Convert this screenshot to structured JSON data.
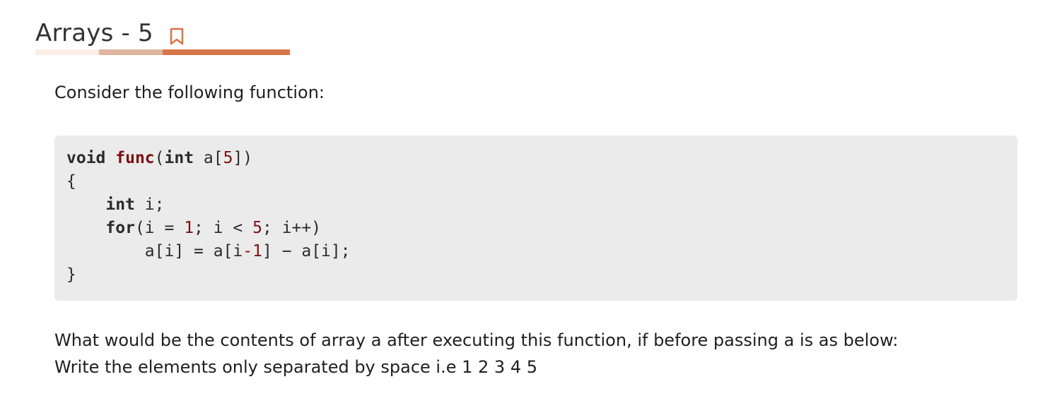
{
  "header": {
    "title": "Arrays - 5",
    "bookmark_icon": "bookmark-icon",
    "accent_color": "#d6774a"
  },
  "intro": {
    "text": "Consider the following function:"
  },
  "code": {
    "lines": [
      [
        {
          "t": "void",
          "c": "kw"
        },
        {
          "t": " ",
          "c": ""
        },
        {
          "t": "func",
          "c": "fn"
        },
        {
          "t": "(",
          "c": ""
        },
        {
          "t": "int",
          "c": "kw"
        },
        {
          "t": " a[",
          "c": ""
        },
        {
          "t": "5",
          "c": "num"
        },
        {
          "t": "])",
          "c": ""
        }
      ],
      [
        {
          "t": "{",
          "c": ""
        }
      ],
      [
        {
          "t": "    ",
          "c": ""
        },
        {
          "t": "int",
          "c": "kw"
        },
        {
          "t": " i;",
          "c": ""
        }
      ],
      [
        {
          "t": "    ",
          "c": ""
        },
        {
          "t": "for",
          "c": "kw"
        },
        {
          "t": "(i = ",
          "c": ""
        },
        {
          "t": "1",
          "c": "num"
        },
        {
          "t": "; i < ",
          "c": ""
        },
        {
          "t": "5",
          "c": "num"
        },
        {
          "t": "; i++)",
          "c": ""
        }
      ],
      [
        {
          "t": "        a[i] = a[i",
          "c": ""
        },
        {
          "t": "-1",
          "c": "num"
        },
        {
          "t": "] − a[i];",
          "c": ""
        }
      ],
      [
        {
          "t": "}",
          "c": ""
        }
      ]
    ]
  },
  "question": {
    "line1": "What would be the contents of array a after executing this function, if before passing a is as below:",
    "line2": "Write the elements only separated by space i.e 1 2 3 4 5"
  }
}
